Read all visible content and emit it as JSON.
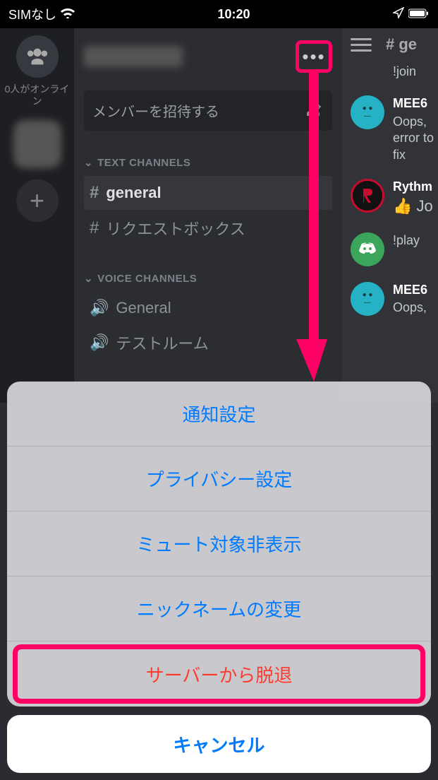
{
  "status": {
    "carrier": "SIMなし",
    "time": "10:20"
  },
  "rail": {
    "online_label": "0人がオンライン"
  },
  "panel": {
    "invite_label": "メンバーを招待する",
    "text_header": "TEXT CHANNELS",
    "voice_header": "VOICE CHANNELS",
    "text_channels": [
      {
        "name": "general",
        "active": true
      },
      {
        "name": "リクエストボックス",
        "active": false
      }
    ],
    "voice_channels": [
      {
        "name": "General"
      },
      {
        "name": "テストルーム"
      }
    ]
  },
  "peek": {
    "channel": "# ge",
    "messages": [
      {
        "user": "",
        "text": "!join",
        "avatar": "none"
      },
      {
        "user": "MEE6",
        "text": "Oops, error to fix",
        "avatar": "mee6"
      },
      {
        "user": "Rythm",
        "text": "👍 Jo",
        "avatar": "rythm"
      },
      {
        "user": "",
        "text": "!play",
        "avatar": "discord"
      },
      {
        "user": "MEE6",
        "text": "Oops,",
        "avatar": "mee6"
      }
    ]
  },
  "sheet": {
    "items": [
      {
        "label": "通知設定",
        "danger": false,
        "highlight": false
      },
      {
        "label": "プライバシー設定",
        "danger": false,
        "highlight": false
      },
      {
        "label": "ミュート対象非表示",
        "danger": false,
        "highlight": false
      },
      {
        "label": "ニックネームの変更",
        "danger": false,
        "highlight": false
      },
      {
        "label": "サーバーから脱退",
        "danger": true,
        "highlight": true
      }
    ],
    "cancel": "キャンセル"
  }
}
